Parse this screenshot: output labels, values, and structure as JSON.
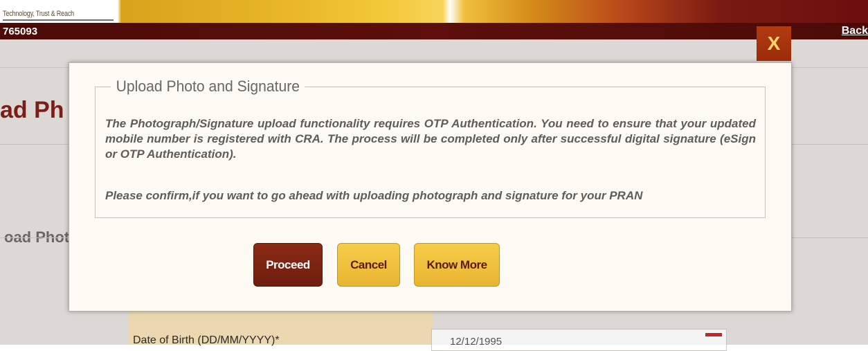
{
  "header": {
    "tagline": "Technology, Trust & Reach",
    "user_id": "765093",
    "back_label": "Back"
  },
  "background": {
    "page_title": "ad Ph",
    "section_title": "oad Phot",
    "dob_label": "Date of Birth (DD/MM/YYYY)*",
    "dob_value": "12/12/1995"
  },
  "modal": {
    "close_label": "X",
    "legend": "Upload Photo and Signature",
    "message": "The Photograph/Signature upload functionality requires OTP Authentication. You need to ensure that your updated mobile number is registered with CRA. The process will be completed only after successful digital signature (eSign or OTP Authentication).",
    "confirm": "Please confirm,if you want to go ahead with uploading photograph and signature for your PRAN",
    "buttons": {
      "proceed": "Proceed",
      "cancel": "Cancel",
      "know_more": "Know More"
    }
  },
  "colors": {
    "brand_dark": "#5c0f0b",
    "accent_gold": "#e9b530",
    "close_bg": "#a8320c"
  }
}
